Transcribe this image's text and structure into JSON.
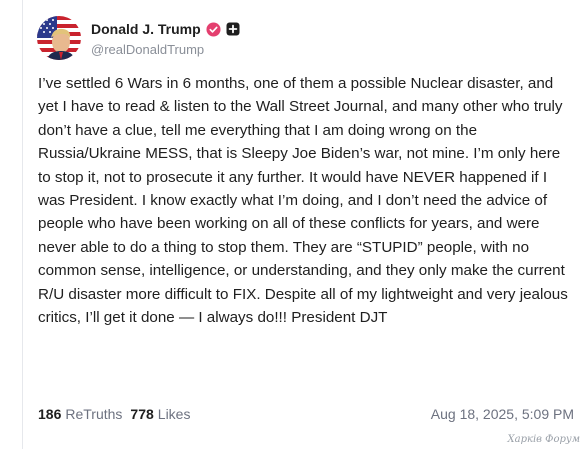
{
  "author": {
    "display_name": "Donald J. Trump",
    "handle": "@realDonaldTrump",
    "verified": true,
    "avatar_icon": "american-flag-avatar-icon"
  },
  "post": {
    "text": "I’ve settled 6 Wars in 6 months, one of them a possible Nuclear disaster, and yet I have to read & listen to the Wall Street Journal, and many other who truly don’t have a clue, tell me everything that I am doing wrong on the Russia/Ukraine MESS, that is Sleepy Joe Biden’s war, not mine. I’m only here to stop it, not to prosecute it any further. It would have NEVER happened if I was President. I know exactly what I’m doing, and I don’t need the advice of people who have been working on all of these conflicts for years, and were never able to do a thing to stop them. They are “STUPID” people, with no common sense, intelligence, or understanding, and they only make the current R/U disaster more difficult to FIX. Despite all of my lightweight and very jealous critics, I’ll get it done — I always do!!! President DJT"
  },
  "stats": {
    "retruths_count": "186",
    "retruths_label": "ReTruths",
    "likes_count": "778",
    "likes_label": "Likes"
  },
  "timestamp": "Aug 18, 2025, 5:09 PM",
  "watermark": "Харків Форум",
  "colors": {
    "verified_badge": "#e43f6f",
    "text": "#1f1f1f",
    "muted": "#6d7280"
  }
}
